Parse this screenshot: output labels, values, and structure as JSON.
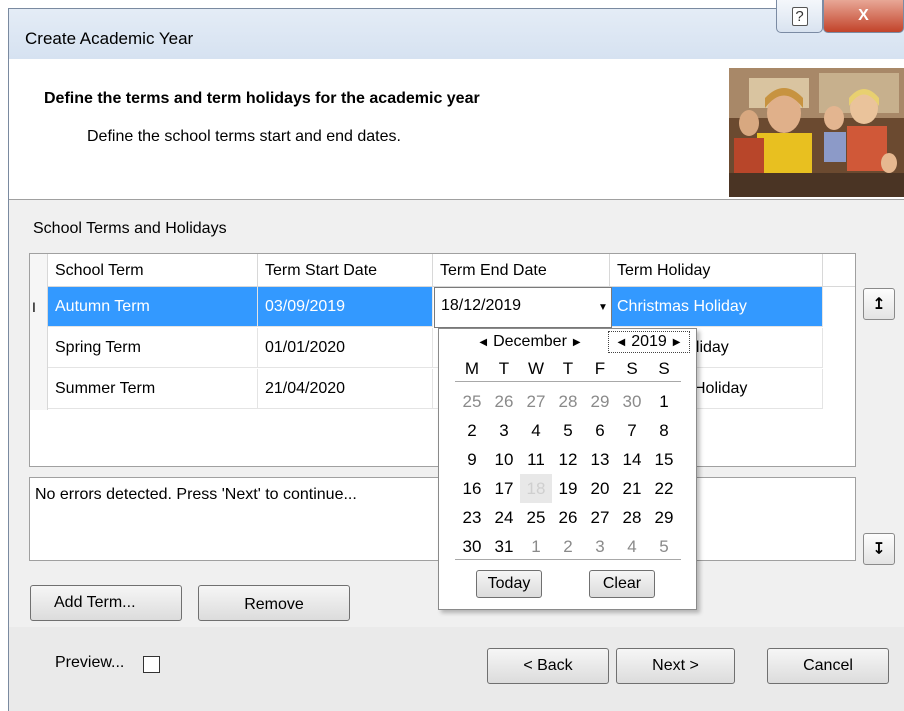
{
  "window": {
    "title": "Create Academic Year",
    "help_glyph": "?",
    "close_glyph": "X"
  },
  "header": {
    "title": "Define the terms and term holidays for the academic year",
    "subtitle": "Define the school terms start and end dates."
  },
  "section_label": "School Terms and Holidays",
  "grid": {
    "columns": [
      "School Term",
      "Term Start Date",
      "Term End Date",
      "Term Holiday"
    ],
    "rows": [
      {
        "term": "Autumn Term",
        "start": "03/09/2019",
        "end": "18/12/2019",
        "holiday": "Christmas Holiday",
        "row_marker": "I"
      },
      {
        "term": "Spring Term",
        "start": "01/01/2020",
        "end": "",
        "holiday": "oliday",
        "row_marker": ""
      },
      {
        "term": "Summer Term",
        "start": "21/04/2020",
        "end": "",
        "holiday": "Holiday",
        "row_marker": ""
      }
    ],
    "editing_value": "18/12/2019",
    "dropdown_glyph": "▼"
  },
  "message": "No errors detected. Press 'Next' to continue...",
  "side_buttons": {
    "up_glyph": "↥",
    "down_glyph": "↧"
  },
  "buttons": {
    "add_term": "Add Term...",
    "remove": "Remove",
    "back": "< Back",
    "next": "Next >",
    "cancel": "Cancel"
  },
  "preview": {
    "label": "Preview...",
    "checked": false
  },
  "calendar": {
    "month": "December",
    "year": "2019",
    "prev_glyph": "◀",
    "next_glyph": "▶",
    "weekdays": [
      "M",
      "T",
      "W",
      "T",
      "F",
      "S",
      "S"
    ],
    "weeks": [
      [
        "25",
        "26",
        "27",
        "28",
        "29",
        "30",
        "1"
      ],
      [
        "2",
        "3",
        "4",
        "5",
        "6",
        "7",
        "8"
      ],
      [
        "9",
        "10",
        "11",
        "12",
        "13",
        "14",
        "15"
      ],
      [
        "16",
        "17",
        "18",
        "19",
        "20",
        "21",
        "22"
      ],
      [
        "23",
        "24",
        "25",
        "26",
        "27",
        "28",
        "29"
      ],
      [
        "30",
        "31",
        "1",
        "2",
        "3",
        "4",
        "5"
      ]
    ],
    "selected_day": "18",
    "today_label": "Today",
    "clear_label": "Clear"
  }
}
